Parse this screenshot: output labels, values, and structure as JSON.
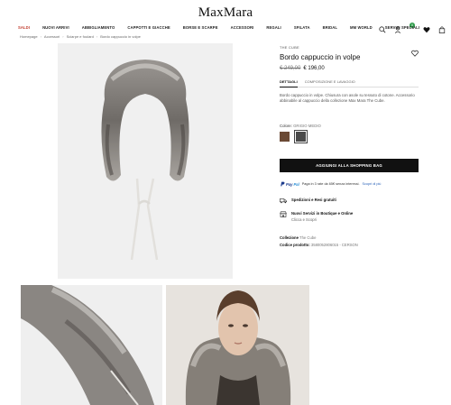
{
  "header": {
    "logo": "MaxMara",
    "nav": [
      "SALDI",
      "NUOVI ARRIVI",
      "ABBIGLIAMENTO",
      "CAPPOTTI E GIACCHE",
      "BORSE E SCARPE",
      "ACCESSORI",
      "REGALI",
      "SFILATA",
      "BRIDAL",
      "MM WORLD",
      "SERVIZI SPECIALI"
    ],
    "icons": [
      "search-icon",
      "user-icon",
      "heart-icon",
      "bag-icon"
    ],
    "cart_badge": "0"
  },
  "breadcrumb": [
    "Homepage",
    "Accessori",
    "Sciarpe e foulard",
    "Bordo cappuccio in volpe"
  ],
  "product": {
    "brandline": "THE CUBE",
    "title": "Bordo cappuccio in volpe",
    "old_price": "€ 249,00",
    "new_price": "€ 196,00",
    "tabs": [
      "DETTAGLI",
      "COMPOSIZIONE E LAVAGGIO"
    ],
    "description": "Bordo cappuccio in volpe. Chiusura con asole su tessuto di cotone. Accessorio abbinabile al cappuccio della collezione Max Mara The Cube.",
    "color_label": "Colore:",
    "color_value": "GRIGIO MEDIO",
    "swatches": [
      "#6b4a35",
      "#4a4a4a"
    ],
    "add_to_bag": "AGGIUNGI ALLA SHOPPING BAG",
    "paypal_brand_a": "Pay",
    "paypal_brand_b": "Pal",
    "paypal_text": "Paga in 3 rate da 65€ senza interessi.",
    "paypal_link": "Scopri di più",
    "services": [
      {
        "title": "Spedizioni e Resi gratuiti",
        "subtitle": ""
      },
      {
        "title": "Nuovi Servizi in Boutique e Online",
        "subtitle": "Clicca e Scopri"
      }
    ],
    "collection_label": "Collezione",
    "collection_value": "The Cube",
    "code_label": "Codice prodotto:",
    "code_value": "3580052806015 - CERSON"
  }
}
